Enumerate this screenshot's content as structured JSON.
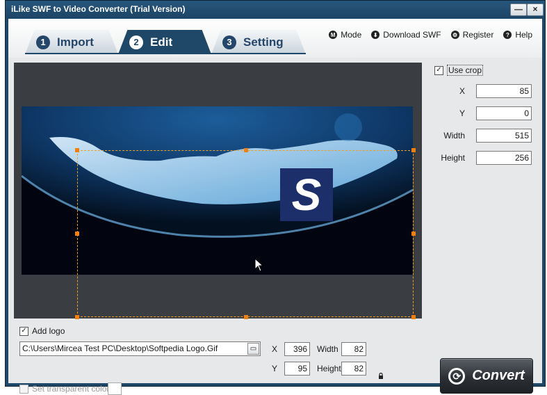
{
  "window": {
    "title": "iLike SWF to Video Converter (Trial Version)",
    "minimize_glyph": "—",
    "close_glyph": "×"
  },
  "tabs": [
    {
      "num": "1",
      "label": "Import"
    },
    {
      "num": "2",
      "label": "Edit"
    },
    {
      "num": "3",
      "label": "Setting"
    }
  ],
  "toplinks": [
    {
      "icon": "M",
      "label": "Mode",
      "icon_name": "mode-icon"
    },
    {
      "icon": "⬇",
      "label": "Download SWF",
      "icon_name": "download-icon"
    },
    {
      "icon": "⚙",
      "label": "Register",
      "icon_name": "register-icon"
    },
    {
      "icon": "?",
      "label": "Help",
      "icon_name": "help-icon"
    }
  ],
  "preview": {
    "logo_letter": "S"
  },
  "crop": {
    "use_crop_label": "Use crop",
    "use_crop_checked": true,
    "x_label": "X",
    "x_value": "85",
    "y_label": "Y",
    "y_value": "0",
    "width_label": "Width",
    "width_value": "515",
    "height_label": "Height",
    "height_value": "256"
  },
  "logo": {
    "add_logo_label": "Add logo",
    "add_logo_checked": true,
    "path": "C:\\Users\\Mircea Test PC\\Desktop\\Softpedia Logo.Gif",
    "x_label": "X",
    "x_value": "396",
    "y_label": "Y",
    "y_value": "95",
    "width_label": "Width",
    "width_value": "82",
    "height_label": "Height",
    "height_value": "82",
    "transparent_label": "Set transparent color"
  },
  "convert": {
    "label": "Convert"
  },
  "colors": {
    "frame": "#1f4768",
    "crop_line": "#f08010",
    "preview_bg": "#3a3d42"
  }
}
